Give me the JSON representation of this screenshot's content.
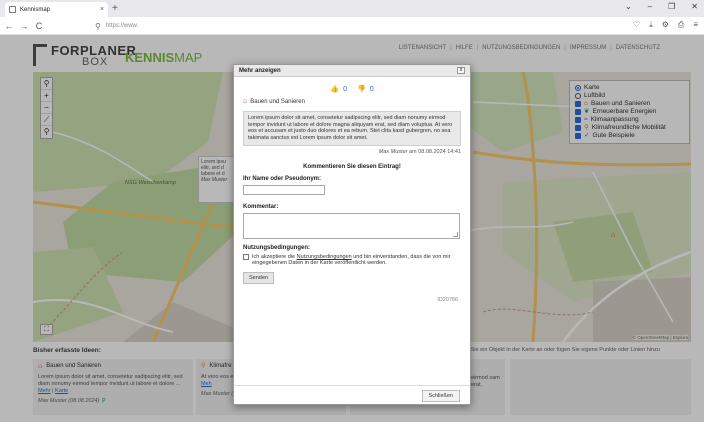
{
  "browser": {
    "tab_title": "Kennismap",
    "url": "https://www.",
    "new_tab": "+",
    "close_tab": "×",
    "window_controls": [
      "⌄",
      "–",
      "❐",
      "✕"
    ],
    "nav": {
      "back": "←",
      "forward": "→",
      "reload": "C"
    },
    "toolbar_icons": [
      "♡",
      "⤓",
      "⚙",
      "⎙",
      "≡"
    ]
  },
  "header": {
    "logo_line1": "FORPLANER",
    "logo_line2": "BOX",
    "logo_k_bold": "KENNIS",
    "logo_k_light": "MAP",
    "nav": [
      "LISTENANSICHT",
      "HILFE",
      "NUTZUNGSBEDINGUNGEN",
      "IMPRESSUM",
      "DATENSCHUTZ"
    ]
  },
  "map": {
    "zoom_in": "+",
    "zoom_out": "−",
    "fullscreen": "⛶",
    "search": "⚲",
    "layers": {
      "base": [
        {
          "label": "Karte",
          "selected": true
        },
        {
          "label": "Luftbild",
          "selected": false
        }
      ],
      "overlays": [
        {
          "label": "Bauen und Sanieren",
          "icon": "house-icon",
          "color": "#d0392b"
        },
        {
          "label": "Erneuerbare Energien",
          "icon": "leaf-icon",
          "color": "#2e8b57"
        },
        {
          "label": "Klimaanpassung",
          "icon": "water-icon",
          "color": "#2a6bd8"
        },
        {
          "label": "Klimafreundliche Mobilität",
          "icon": "bike-icon",
          "color": "#e08a1e"
        },
        {
          "label": "Gute Beispiele",
          "icon": "thumb-icon",
          "color": "#7a3fb0"
        }
      ]
    },
    "popup_text": "Lorem ipsu elitr, sed d labore et d",
    "popup_author": "Max Muster",
    "label_nsg": "NSG Weischenkamp",
    "attribution": "© OpenStreetMap | Esplora"
  },
  "ideas": {
    "heading": "Bisher erfasste Ideen:",
    "hint": "n Sie ein Objekt in der Karte an oder fügen Sie eigene Punkte oder Linien hinzu",
    "cards": [
      {
        "title": "Bauen und Sanieren",
        "text": "Lorem ipsum dolor sit amet, consetetur sadipscing elitr, sed diam nonumy eirmod tempor invidunt ut labore et dolore ...",
        "more": "Mehr",
        "map": "Karte",
        "meta": "Max Muster (08.08.2024)"
      },
      {
        "title": "Klimafre",
        "text": "At vero eos et Stet clita kasd Lorem...",
        "more": "Meh",
        "meta": "Max Muster (0"
      },
      {
        "title": "",
        "text": "eirmod sam erat,",
        "more": "",
        "meta": ""
      }
    ]
  },
  "modal": {
    "title": "Mehr anzeigen",
    "close_x": "x",
    "likes": "0",
    "dislikes": "0",
    "category": "Bauen und Sanieren",
    "description": "Lorem ipsum dolor sit amet, consetetur sadipscing elitr, sed diam nonumy eirmod tempor invidunt ut labore et dolore magna aliquyam erat, sed diam voluptua. At vero eos et accusam et justo duo dolores et ea rebum. Stet clita kasd gubergren, no sea takimata sanctus est Lorem ipsum dolor sit amet.",
    "author": "Max Muster",
    "author_suffix": "am 08.08.2024 14:41",
    "comment_heading": "Kommentieren Sie diesen Eintrag!",
    "name_label": "Ihr Name oder Pseudonym:",
    "comment_label": "Kommentar:",
    "terms_label": "Nutzungsbedingungen:",
    "terms_text_1": "Ich akzeptiere die",
    "terms_link": "Nutzungsbedingungen",
    "terms_text_2": "und bin einverstanden, dass die von mir eingegebenen Daten in der Karte veröffentlicht werden.",
    "send": "Senden",
    "captcha_id": "ID20786",
    "close": "Schließen"
  }
}
